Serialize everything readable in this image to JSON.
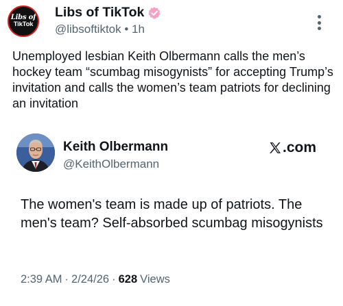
{
  "post": {
    "author": {
      "name": "Libs of TikTok",
      "handle": "@libsoftiktok",
      "separator": "•",
      "time": "1h",
      "avatar_text_1": "Libs of",
      "avatar_text_2": "TikTok",
      "verified": true
    },
    "text": "Unemployed lesbian Keith Olbermann calls the men’s hockey team “scumbag misogynists” for accepting Trump’s invitation and calls the women’s team patriots for declining an invitation"
  },
  "quote": {
    "author": {
      "name": "Keith Olbermann",
      "handle": "@KeithOlbermann"
    },
    "source": ".com",
    "text": "The women's team is made up of patriots. The men's team? Self-absorbed scumbag misogynists",
    "time": "2:39 AM",
    "date": "2/24/26",
    "views_count": "628",
    "views_label": "Views",
    "dot": "·"
  },
  "colors": {
    "text": "#0f1419",
    "secondary": "#536471",
    "verified": "#f4a3c6",
    "avatar_ring": "#d32020"
  },
  "icons": {
    "verified": "verified-badge-icon",
    "more": "more-vertical-icon",
    "x": "x-logo-icon"
  }
}
